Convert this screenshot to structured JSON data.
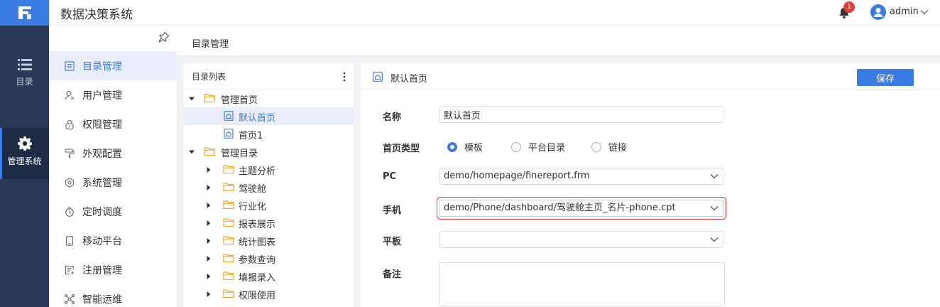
{
  "header": {
    "title": "数据决策系统",
    "notification_count": "1",
    "user_name": "admin"
  },
  "rail": {
    "items": [
      {
        "label": "目录",
        "icon": "list-icon"
      },
      {
        "label": "管理系统",
        "icon": "gear-icon"
      }
    ]
  },
  "sidebar": {
    "items": [
      {
        "label": "目录管理",
        "icon": "catalog-icon"
      },
      {
        "label": "用户管理",
        "icon": "user-icon"
      },
      {
        "label": "权限管理",
        "icon": "lock-icon"
      },
      {
        "label": "外观配置",
        "icon": "paint-roller-icon"
      },
      {
        "label": "系统管理",
        "icon": "settings-icon"
      },
      {
        "label": "定时调度",
        "icon": "timer-icon"
      },
      {
        "label": "移动平台",
        "icon": "mobile-icon"
      },
      {
        "label": "注册管理",
        "icon": "register-icon"
      },
      {
        "label": "智能运维",
        "icon": "network-icon"
      }
    ]
  },
  "breadcrumb": "目录管理",
  "tree": {
    "header": "目录列表",
    "nodes": [
      {
        "label": "管理首页",
        "level": 0,
        "type": "folder",
        "arrow": "down"
      },
      {
        "label": "默认首页",
        "level": 1,
        "type": "page",
        "selected": true
      },
      {
        "label": "首页1",
        "level": 1,
        "type": "page"
      },
      {
        "label": "管理目录",
        "level": 0,
        "type": "folder",
        "arrow": "down"
      },
      {
        "label": "主题分析",
        "level": 1,
        "type": "folder",
        "arrow": "right"
      },
      {
        "label": "驾驶舱",
        "level": 1,
        "type": "folder",
        "arrow": "right"
      },
      {
        "label": "行业化",
        "level": 1,
        "type": "folder",
        "arrow": "right"
      },
      {
        "label": "报表展示",
        "level": 1,
        "type": "folder",
        "arrow": "right"
      },
      {
        "label": "统计图表",
        "level": 1,
        "type": "folder",
        "arrow": "right"
      },
      {
        "label": "参数查询",
        "level": 1,
        "type": "folder",
        "arrow": "right"
      },
      {
        "label": "填报录入",
        "level": 1,
        "type": "folder",
        "arrow": "right"
      },
      {
        "label": "权限使用",
        "level": 1,
        "type": "folder",
        "arrow": "right"
      }
    ]
  },
  "form": {
    "title": "默认首页",
    "save_label": "保存",
    "name_label": "名称",
    "name_value": "默认首页",
    "type_label": "首页类型",
    "type_options": [
      "模板",
      "平台目录",
      "链接"
    ],
    "type_selected": "模板",
    "pc_label": "PC",
    "pc_value": "demo/homepage/finereport.frm",
    "phone_label": "手机",
    "phone_value": "demo/Phone/dashboard/驾驶舱主页_名片-phone.cpt",
    "tablet_label": "平板",
    "tablet_value": "",
    "note_label": "备注",
    "note_value": ""
  },
  "colors": {
    "accent": "#3a7ce1",
    "rail_bg": "#293957",
    "folder": "#f5a623",
    "highlight_border": "#e03e3e"
  }
}
